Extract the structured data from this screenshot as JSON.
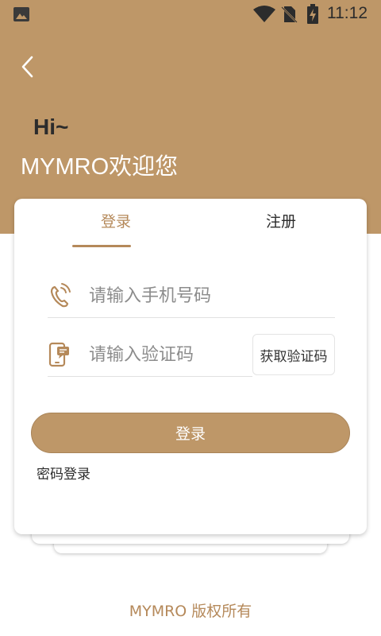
{
  "status_bar": {
    "time": "11:12"
  },
  "header": {
    "greeting": "Hi~",
    "welcome": "MYMRO欢迎您"
  },
  "tabs": [
    {
      "label": "登录",
      "active": true
    },
    {
      "label": "注册",
      "active": false
    }
  ],
  "form": {
    "phone_placeholder": "请输入手机号码",
    "phone_value": "",
    "code_placeholder": "请输入验证码",
    "code_value": "",
    "get_code_label": "获取验证码",
    "login_label": "登录",
    "password_login_label": "密码登录"
  },
  "footer": {
    "copyright": "MYMRO 版权所有"
  },
  "colors": {
    "brand": "#be9768",
    "accent_text": "#b5895a",
    "dark_text": "#2c2c2c"
  },
  "icons": {
    "status_left": "image-icon",
    "wifi": "wifi-icon",
    "sim": "no-sim-icon",
    "battery": "battery-charging-icon",
    "back": "chevron-left-icon",
    "phone": "phone-icon",
    "code": "mobile-message-icon"
  }
}
